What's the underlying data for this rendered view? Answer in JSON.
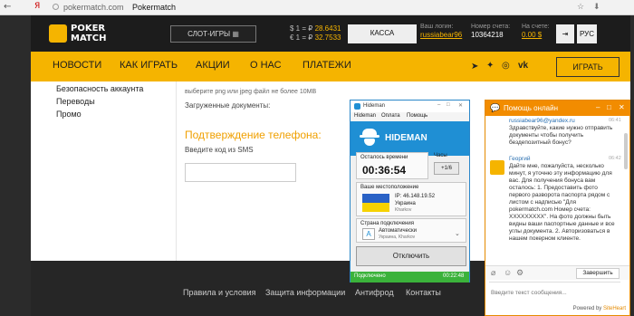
{
  "browser": {
    "nav_back": "←",
    "nav_icon": "Я",
    "url_host": "pokermatch.com",
    "page_title": "Pokermatch"
  },
  "header": {
    "logo_line1": "POKER",
    "logo_line2": "MATCH",
    "slots_button": "СЛОТ-ИГРЫ",
    "rate_usd_label": "$ 1 = ₽",
    "rate_usd": "28.6431",
    "rate_eur_label": "€ 1 = ₽",
    "rate_eur": "32.7533",
    "kassa_button": "КАССА",
    "login_label": "Ваш логин:",
    "login_value": "russiabear96",
    "account_label": "Номер счета:",
    "account_value": "10364218",
    "balance_label": "На счете:",
    "balance_value": "0.00 $",
    "lang_button": "РУС"
  },
  "menu": {
    "items": [
      "НОВОСТИ",
      "КАК ИГРАТЬ",
      "АКЦИИ",
      "О НАС",
      "ПЛАТЕЖИ"
    ],
    "play_button": "ИГРАТЬ"
  },
  "content": {
    "sidebar": [
      "Безопасность аккаунта",
      "Переводы",
      "Промо"
    ],
    "file_hint": "выберите png или jpeg файл не более 10MB",
    "uploaded_docs": "Загруженные документы:",
    "phone_heading": "Подтверждение телефона:",
    "sms_label": "Введите код из SMS",
    "sms_value": ""
  },
  "footer": {
    "links": [
      "Правила и условия",
      "Защита информации",
      "Антифрод",
      "Контакты"
    ]
  },
  "hideman": {
    "window_title": "Hideman",
    "menu": [
      "Hideman",
      "Оплата",
      "Помощь"
    ],
    "brand": "HIDEMAN",
    "time_left_label": "Осталось времени",
    "time_left": "00:36:54",
    "hours_label": "Часы",
    "hours_button": "+1/6",
    "location_label": "Ваше местоположение",
    "ip": "IP: 46.148.19.52",
    "country": "Украина",
    "city": "Kharkov",
    "connect_country_label": "Страна подключения",
    "auto_label": "Автоматически",
    "auto_sub": "Украина, Kharkov",
    "disconnect_button": "Отключить",
    "status": "Подключено",
    "status_time": "00:22:48"
  },
  "chat": {
    "title": "Помощь онлайн",
    "user_email": "russiabear96@yandex.ru",
    "user_time": "06:41",
    "user_message": "Здравствуйте, какие нужно отправить документы чтобы получить бездепозитный бонус?",
    "agent_name": "Георгий",
    "agent_time": "06:42",
    "agent_message": "Дайте мне, пожалуйста, несколько минут, я уточню эту информацию для вас. Для получения бонуса вам осталось: 1. Предоставить фото первого разворота паспорта рядом с листом с надписью \"Для pokermatch.com Номер счета: XXXXXXXXX\". На фото должны быть видны ваши паспортные данные и все углы документа. 2. Авторизоваться в нашем покерном клиенте.",
    "end_button": "Завершить",
    "input_placeholder": "Введите текст сообщения...",
    "powered_by": "Powered by",
    "powered_brand": "SiteHeart"
  }
}
